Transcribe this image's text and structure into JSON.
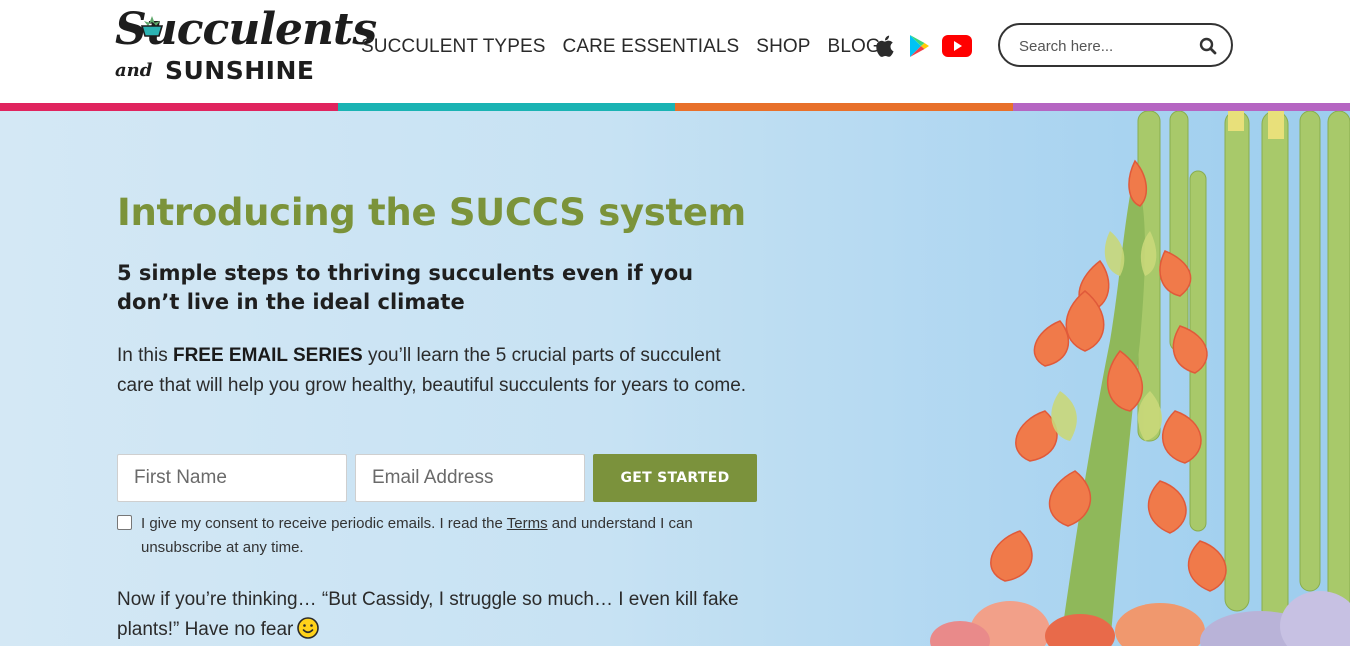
{
  "brand": {
    "logo_script": "Succulents",
    "logo_and": "and",
    "logo_sunshine": "SUNSHINE"
  },
  "nav": {
    "items": [
      {
        "label": "SUCCULENT TYPES"
      },
      {
        "label": "CARE ESSENTIALS"
      },
      {
        "label": "SHOP"
      },
      {
        "label": "BLOG"
      }
    ]
  },
  "social": {
    "icons": [
      "apple-podcasts-icon",
      "google-play-icon",
      "youtube-icon"
    ]
  },
  "search": {
    "placeholder": "Search here..."
  },
  "stripe_colors": [
    "#e0245e",
    "#1ab3b3",
    "#e8702a",
    "#b565c2"
  ],
  "hero": {
    "headline": "Introducing the SUCCS system",
    "subheadline": "5 simple steps to thriving succulents even if you don’t live in the ideal climate",
    "intro_prefix": "In this ",
    "intro_bold": "FREE EMAIL SERIES",
    "intro_suffix": " you’ll learn the 5 crucial parts of succulent care that will help you grow healthy, beautiful succulents for years to come.",
    "form": {
      "first_name_placeholder": "First Name",
      "email_placeholder": "Email Address",
      "submit_label": "GET STARTED"
    },
    "consent_prefix": "I give my consent to receive periodic emails. I read the ",
    "consent_link": "Terms",
    "consent_suffix": " and understand I can unsubscribe at any time.",
    "more_text": "Now if you’re thinking… “But Cassidy, I struggle so much… I even kill fake plants!” Have no fear"
  },
  "colors": {
    "accent_green": "#7b933a",
    "button_green": "#7b923c",
    "hero_bg": "#c7e2f3"
  }
}
